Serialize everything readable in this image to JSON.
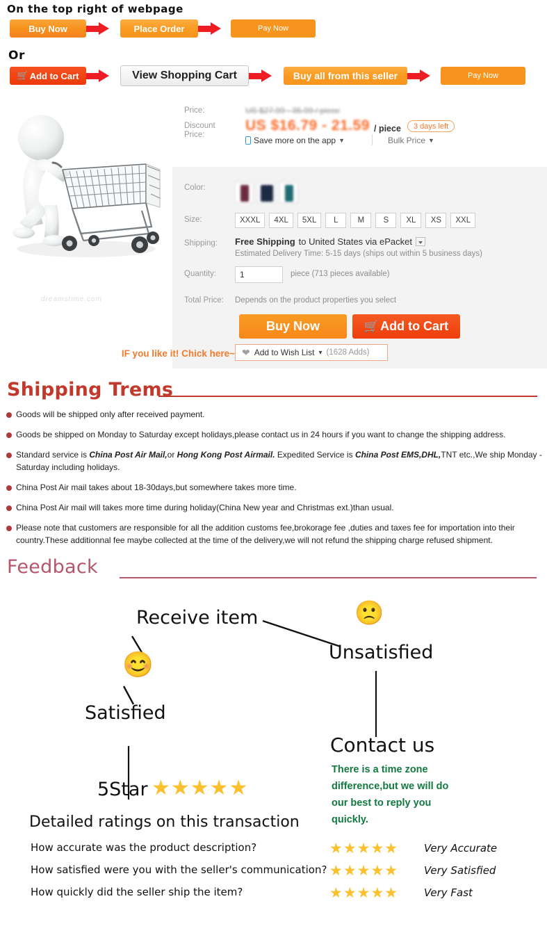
{
  "flow": {
    "caption_top": "On the top right of webpage",
    "caption_or": "Or",
    "row1": [
      {
        "label": "Buy Now",
        "style": "orange"
      },
      {
        "label": "Place Order",
        "style": "orange2"
      },
      {
        "label": "Pay Now",
        "style": "paynow"
      }
    ],
    "row2": [
      {
        "label": "Add to Cart",
        "style": "redorange",
        "icon": "cart-icon"
      },
      {
        "label": "View Shopping Cart",
        "style": "grey"
      },
      {
        "label": "Buy all from this seller",
        "style": "orange2"
      },
      {
        "label": "Pay Now",
        "style": "paynow"
      }
    ]
  },
  "product": {
    "watermark": "dreamstime.com",
    "price": {
      "label": "Price:",
      "original": "US $27.99 - 35.99 / piece",
      "discount_label_line1": "Discount",
      "discount_label_line2": "Price:",
      "discount": "US $16.79 - 21.59",
      "unit": "/ piece",
      "badge": "3 days left",
      "app_save": "Save more on the app",
      "bulk_price": "Bulk Price"
    },
    "color": {
      "label": "Color:",
      "swatches": [
        "#6b2c3e",
        "#1c2a44",
        "#1f6d73"
      ]
    },
    "size": {
      "label": "Size:",
      "options": [
        "XXXL",
        "4XL",
        "5XL",
        "L",
        "M",
        "S",
        "XL",
        "XS",
        "XXL"
      ]
    },
    "shipping": {
      "label": "Shipping:",
      "free": "Free Shipping",
      "dest": "to  United States via ePacket",
      "estimate": "Estimated Delivery Time: 5-15 days (ships out within 5 business days)"
    },
    "quantity": {
      "label": "Quantity:",
      "value": "1",
      "note": "piece (713 pieces available)"
    },
    "total": {
      "label": "Total Price:",
      "note": "Depends on the product properties you select"
    },
    "cta": {
      "buy_now": "Buy Now",
      "add_to_cart": "Add to Cart"
    },
    "wish": {
      "hint": "IF you like it! Chick here~",
      "label": "Add to Wish List",
      "count": "(1628 Adds)"
    }
  },
  "terms": {
    "title": "Shipping Trems",
    "bullets": [
      "Goods will be shipped only after received payment.",
      "Goods be shipped on Monday to Saturday except  holidays,please contact us in 24 hours if you want to change the shipping address.",
      "Standard service is China Post Air Mail,or Hong Kong Post Airmail. Expedited Service is China Post EMS,DHL,TNT etc.,We ship Monday - Saturday including holidays.",
      "China Post Air mail takes about 18-30days,but somewhere takes more time.",
      "China Post Air mail will takes more time during holiday(China New year and Christmas ext.)than usual.",
      "Please note that customers are responsible for all the addition customs fee,brokorage fee ,duties and taxes fee for importation into their country.These additionnal fee maybe collected at the time of the delivery,we will not refund the shipping charge refused shipment."
    ]
  },
  "feedback": {
    "title": "Feedback",
    "receive_item": "Receive item",
    "satisfied": "Satisfied",
    "unsatisfied": "Unsatisfied",
    "five_star": "5Star",
    "stars_main": "★★★★★",
    "contact_title": "Contact us",
    "contact_note": "There is a time zone difference,but we will do our best to reply you quickly.",
    "detailed_title": "Detailed ratings on this transaction",
    "ratings": [
      {
        "question": "How accurate was the product description?",
        "stars": "★★★★★",
        "label": "Very Accurate"
      },
      {
        "question": "How satisfied were you with the seller's communication?",
        "stars": "★★★★★",
        "label": "Very Satisfied"
      },
      {
        "question": "How quickly did the seller ship the item?",
        "stars": "★★★★★",
        "label": "Very Fast"
      }
    ]
  },
  "colors": {
    "terms_heading": "#c0392b",
    "feedback_heading": "#b5566a",
    "accent_orange": "#f7941e",
    "cta_red": "#ef3d0c",
    "contact_green": "#127a3f",
    "star_yellow": "#fbc02d"
  }
}
